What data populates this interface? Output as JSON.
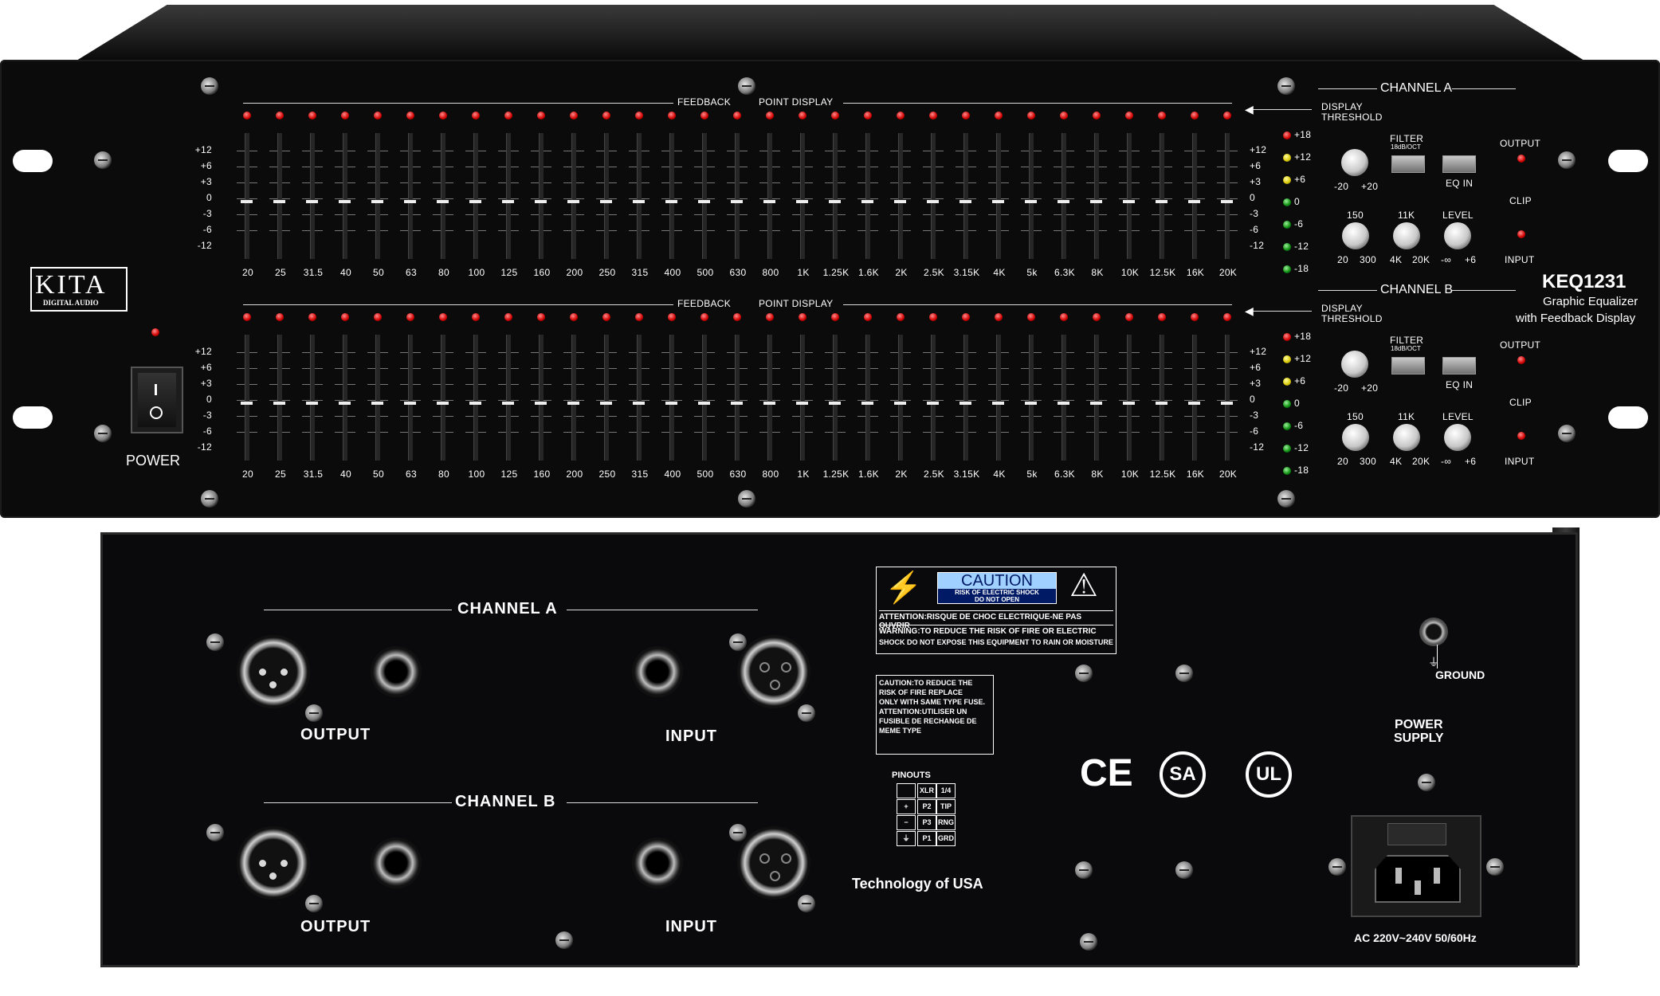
{
  "brand": {
    "name": "KITA",
    "sub": "DIGITAL AUDIO"
  },
  "model": {
    "number": "KEQ1231",
    "line1": "Graphic Equalizer",
    "line2": "with Feedback Display"
  },
  "front": {
    "power_label": "POWER",
    "feedback_label": "FEEDBACK",
    "point_display_label": "POINT DISPLAY",
    "db_scale": [
      "+12",
      "+6",
      "+3",
      "0",
      "-3",
      "-6",
      "-12"
    ],
    "frequencies": [
      "20",
      "25",
      "31.5",
      "40",
      "50",
      "63",
      "80",
      "100",
      "125",
      "160",
      "200",
      "250",
      "315",
      "400",
      "500",
      "630",
      "800",
      "1K",
      "1.25K",
      "1.6K",
      "2K",
      "2.5K",
      "3.15K",
      "4K",
      "5k",
      "6.3K",
      "8K",
      "10K",
      "12.5K",
      "16K",
      "20K"
    ],
    "meter_labels": [
      "+18",
      "+12",
      "+6",
      "0",
      "-6",
      "-12",
      "-18"
    ],
    "meter_colors": [
      "red",
      "yel",
      "yel",
      "grn",
      "grn",
      "grn",
      "grn"
    ],
    "channels": [
      {
        "name": "CHANNEL A",
        "display_threshold_1": "DISPLAY",
        "display_threshold_2": "THRESHOLD",
        "filter": "FILTER",
        "filter_slope": "18dB/OCT",
        "eq_in": "EQ IN",
        "output": "OUTPUT",
        "clip": "CLIP",
        "input": "INPUT",
        "level": "LEVEL",
        "thr_min": "-20",
        "thr_max": "+20",
        "lo_cut": "150",
        "hi_cut": "11K",
        "lo_min": "20",
        "lo_max": "300",
        "hi_min": "4K",
        "hi_max": "20K",
        "level_min": "-∞",
        "level_max": "+6"
      },
      {
        "name": "CHANNEL B",
        "display_threshold_1": "DISPLAY",
        "display_threshold_2": "THRESHOLD",
        "filter": "FILTER",
        "filter_slope": "18dB/OCT",
        "eq_in": "EQ IN",
        "output": "OUTPUT",
        "clip": "CLIP",
        "input": "INPUT",
        "level": "LEVEL",
        "thr_min": "-20",
        "thr_max": "+20",
        "lo_cut": "150",
        "hi_cut": "11K",
        "lo_min": "20",
        "lo_max": "300",
        "hi_min": "4K",
        "hi_max": "20K",
        "level_min": "-∞",
        "level_max": "+6"
      }
    ]
  },
  "rear": {
    "channel_a": "CHANNEL A",
    "channel_b": "CHANNEL B",
    "output": "OUTPUT",
    "input": "INPUT",
    "ground": "GROUND",
    "power_supply_1": "POWER",
    "power_supply_2": "SUPPLY",
    "ac_label": "AC 220V~240V 50/60Hz",
    "technology": "Technology of USA",
    "caution_title": "CAUTION",
    "caution_sub1": "RISK OF ELECTRIC SHOCK",
    "caution_sub2": "DO NOT OPEN",
    "attention_1": "ATTENTION:RISQUE DE CHOC ELECTRIQUE-NE PAS OUVRIR",
    "warning_1": "WARNING:TO REDUCE THE RISK OF FIRE OR ELECTRIC",
    "warning_2": "SHOCK DO NOT EXPOSE THIS EQUIPMENT TO RAIN OR MOISTURE",
    "fuse_1": "CAUTION:TO REDUCE THE",
    "fuse_2": "RISK OF FIRE REPLACE",
    "fuse_3": "ONLY WITH SAME TYPE FUSE.",
    "fuse_4": "ATTENTION:UTILISER UN",
    "fuse_5": "FUSIBLE DE RECHANGE DE",
    "fuse_6": "MEME TYPE",
    "pinouts": "PINOUTS",
    "pin_rows": [
      [
        "",
        "XLR",
        "1/4"
      ],
      [
        "+",
        "P2",
        "TIP"
      ],
      [
        "−",
        "P3",
        "RNG"
      ],
      [
        "⏚",
        "P1",
        "GRD"
      ]
    ],
    "certs": [
      "CE",
      "SA",
      "UL"
    ]
  }
}
